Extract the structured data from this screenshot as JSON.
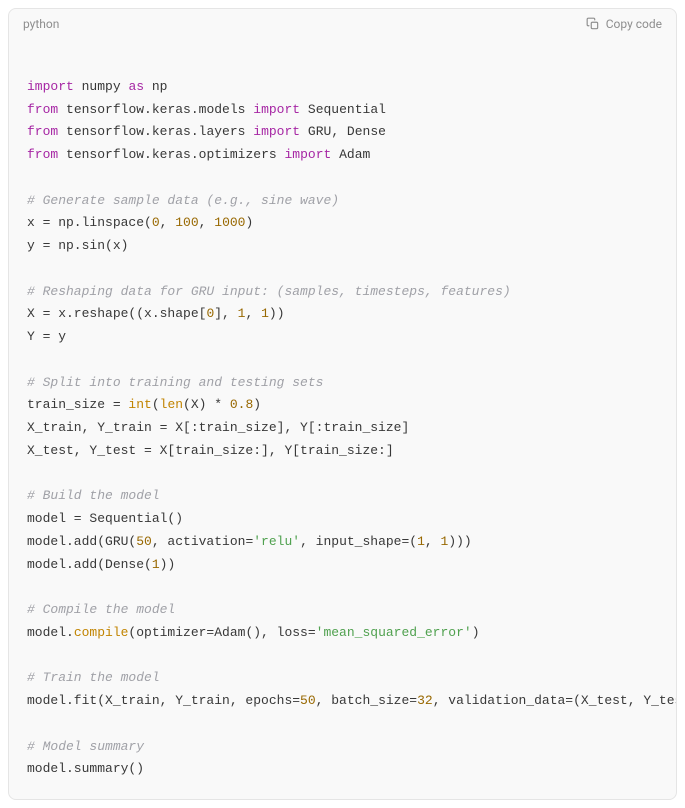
{
  "header": {
    "language": "python",
    "copy_label": "Copy code"
  },
  "code": {
    "imports": {
      "kw_import": "import",
      "kw_from": "from",
      "kw_as": "as",
      "numpy": "numpy",
      "np": "np",
      "tf_models": "tensorflow.keras.models",
      "sequential": "Sequential",
      "tf_layers": "tensorflow.keras.layers",
      "gru": "GRU",
      "dense": "Dense",
      "tf_opt": "tensorflow.keras.optimizers",
      "adam": "Adam",
      "comma": ", "
    },
    "gen": {
      "comment": "# Generate sample data (e.g., sine wave)",
      "l1a": "x = np.linspace(",
      "n0": "0",
      "n100": "100",
      "n1000": "1000",
      "l1b": ")",
      "l2": "y = np.sin(x)"
    },
    "reshape": {
      "comment": "# Reshaping data for GRU input: (samples, timesteps, features)",
      "l1a": "X = x.reshape((x.shape[",
      "n0": "0",
      "l1b": "], ",
      "n1a": "1",
      "l1c": ", ",
      "n1b": "1",
      "l1d": "))",
      "l2": "Y = y"
    },
    "split": {
      "comment": "# Split into training and testing sets",
      "l1a": "train_size = ",
      "int": "int",
      "l1b": "(",
      "len": "len",
      "l1c": "(X) * ",
      "n08": "0.8",
      "l1d": ")",
      "l2": "X_train, Y_train = X[:train_size], Y[:train_size]",
      "l3": "X_test, Y_test = X[train_size:], Y[train_size:]"
    },
    "build": {
      "comment": "# Build the model",
      "l1": "model = Sequential()",
      "l2a": "model.add(GRU(",
      "n50": "50",
      "l2b": ", activation=",
      "relu": "'relu'",
      "l2c": ", input_shape=(",
      "n1a": "1",
      "l2d": ", ",
      "n1b": "1",
      "l2e": ")))",
      "l3a": "model.add(Dense(",
      "n1c": "1",
      "l3b": "))"
    },
    "compile": {
      "comment": "# Compile the model",
      "l1a": "model.",
      "compile": "compile",
      "l1b": "(optimizer=Adam(), loss=",
      "mse": "'mean_squared_error'",
      "l1c": ")"
    },
    "train": {
      "comment": "# Train the model",
      "l1a": "model.fit(X_train, Y_train, epochs=",
      "n50": "50",
      "l1b": ", batch_size=",
      "n32": "32",
      "l1c": ", validation_data=(X_test, Y_test))"
    },
    "summary": {
      "comment": "# Model summary",
      "l1": "model.summary()"
    }
  }
}
